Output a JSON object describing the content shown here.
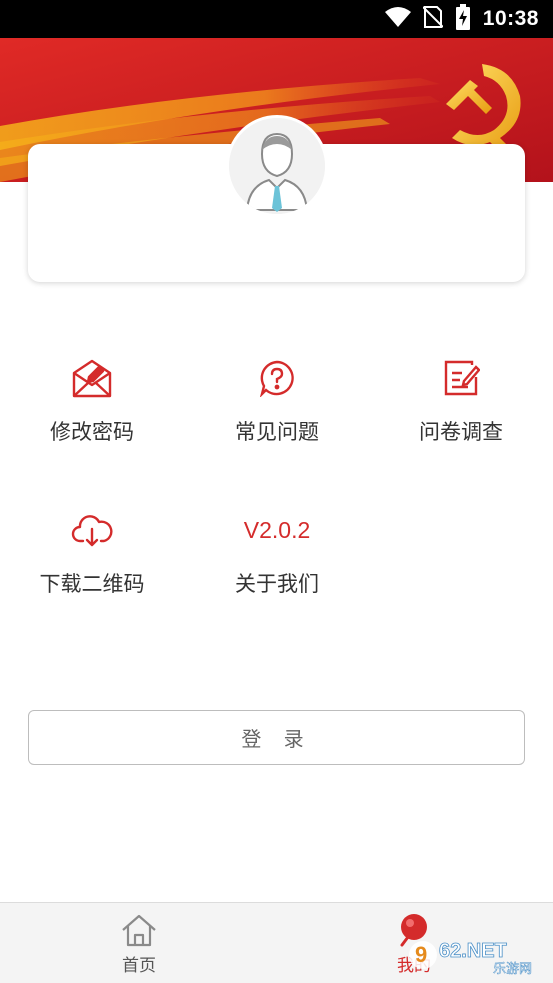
{
  "status_bar": {
    "time": "10:38"
  },
  "profile": {},
  "menu": [
    {
      "label": "修改密码",
      "icon": "envelope-edit-icon"
    },
    {
      "label": "常见问题",
      "icon": "question-bubble-icon"
    },
    {
      "label": "问卷调查",
      "icon": "survey-edit-icon"
    },
    {
      "label": "下载二维码",
      "icon": "cloud-download-icon"
    },
    {
      "label": "关于我们",
      "version": "V2.0.2"
    }
  ],
  "login_button": "登 录",
  "tabs": [
    {
      "label": "首页",
      "icon": "home-icon"
    },
    {
      "label": "我的",
      "icon": "profile-pin-icon"
    }
  ],
  "watermark": {
    "text": "962.NET",
    "subtext": "乐游网"
  },
  "colors": {
    "accent": "#d42b2b",
    "banner": "#c81c22",
    "tab_active": "#d42b2b",
    "tab_inactive": "#555555"
  }
}
